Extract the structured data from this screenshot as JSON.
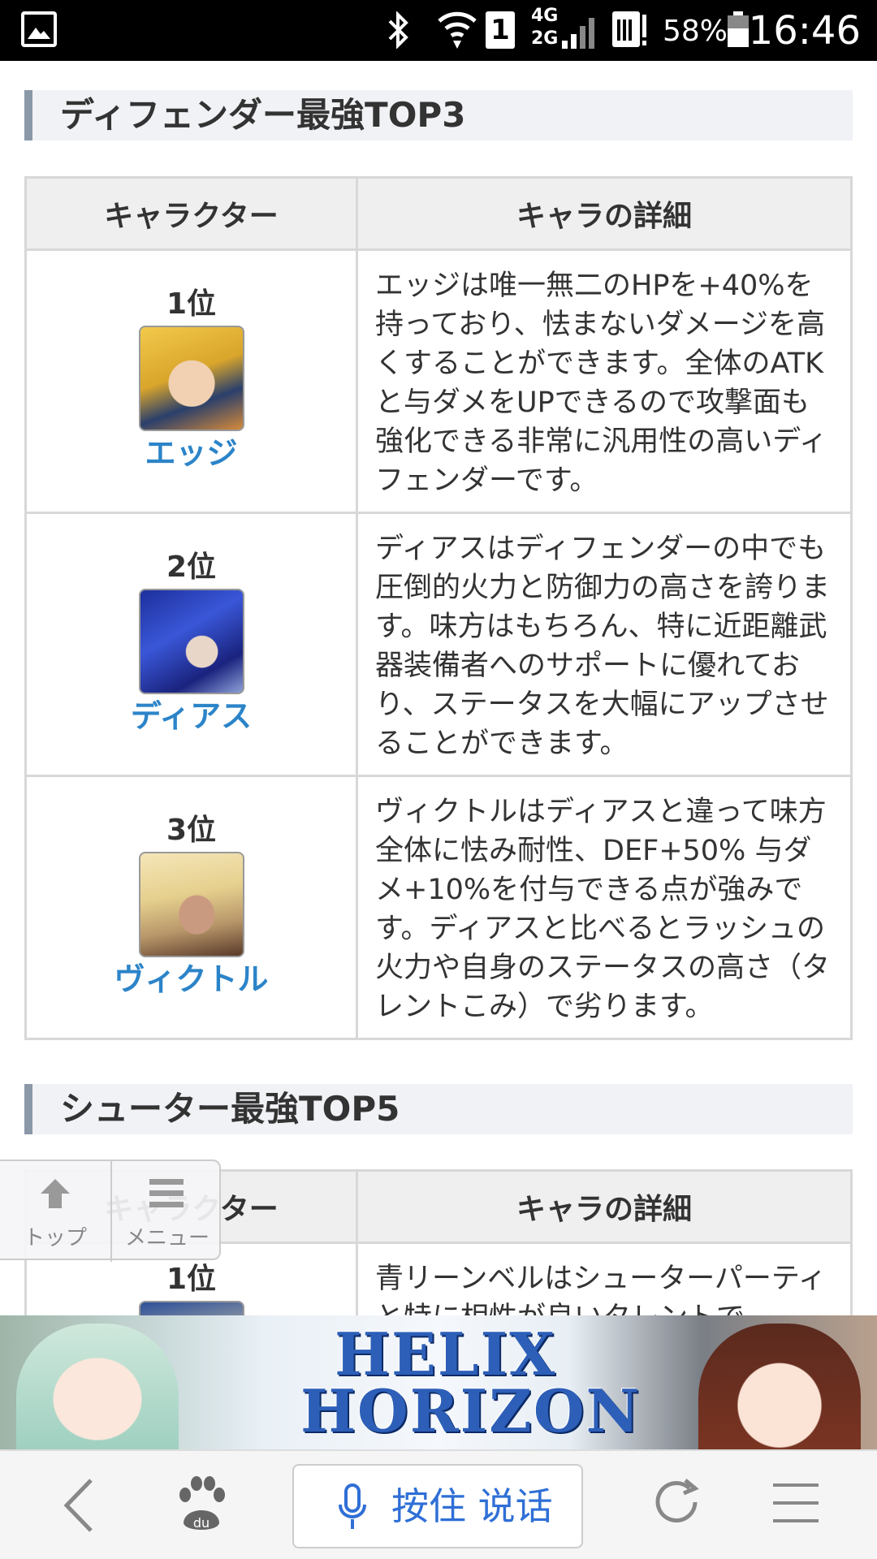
{
  "status_bar": {
    "network_type_top": "4G",
    "network_type_bottom": "2G",
    "sim_slot": "1",
    "battery_percent": "58%",
    "time": "16:46"
  },
  "sections": [
    {
      "title": "ディフェンダー最強TOP3",
      "columns": [
        "キャラクター",
        "キャラの詳細"
      ],
      "rows": [
        {
          "rank": "1位",
          "name": "エッジ",
          "desc": "エッジは唯一無二のHPを+40%を持っており、怯まないダメージを高くすることができます。全体のATKと与ダメをUPできるので攻撃面も強化できる非常に汎用性の高いディフェンダーです。"
        },
        {
          "rank": "2位",
          "name": "ディアス",
          "desc": "ディアスはディフェンダーの中でも圧倒的火力と防御力の高さを誇ります。味方はもちろん、特に近距離武器装備者へのサポートに優れており、ステータスを大幅にアップさせることができます。"
        },
        {
          "rank": "3位",
          "name": "ヴィクトル",
          "desc": "ヴィクトルはディアスと違って味方全体に怯み耐性、DEF+50% 与ダメ+10%を付与できる点が強みです。ディアスと比べるとラッシュの火力や自身のステータスの高さ（タレントこみ）で劣ります。"
        }
      ]
    },
    {
      "title": "シューター最強TOP5",
      "columns": [
        "キャラクター",
        "キャラの詳細"
      ],
      "rows": [
        {
          "rank": "1位",
          "name": "",
          "desc": "青リーンベルはシューターパーティと特に相性が良いタレントで"
        }
      ]
    }
  ],
  "float_nav": {
    "top_label": "トップ",
    "menu_label": "メニュー"
  },
  "banner": {
    "logo_line1": "HELIX",
    "logo_line2": "HORIZON"
  },
  "browser_bar": {
    "voice_label": "按住 说话"
  },
  "icons": {
    "gallery": "image-icon",
    "bluetooth": "bluetooth-icon",
    "wifi": "wifi-icon",
    "signal": "signal-icon",
    "sim": "sim-card-icon",
    "battery": "battery-icon",
    "back": "back-arrow-icon",
    "baidu": "baidu-paw-icon",
    "mic": "mic-icon",
    "refresh": "refresh-icon",
    "menu": "hamburger-menu-icon"
  }
}
